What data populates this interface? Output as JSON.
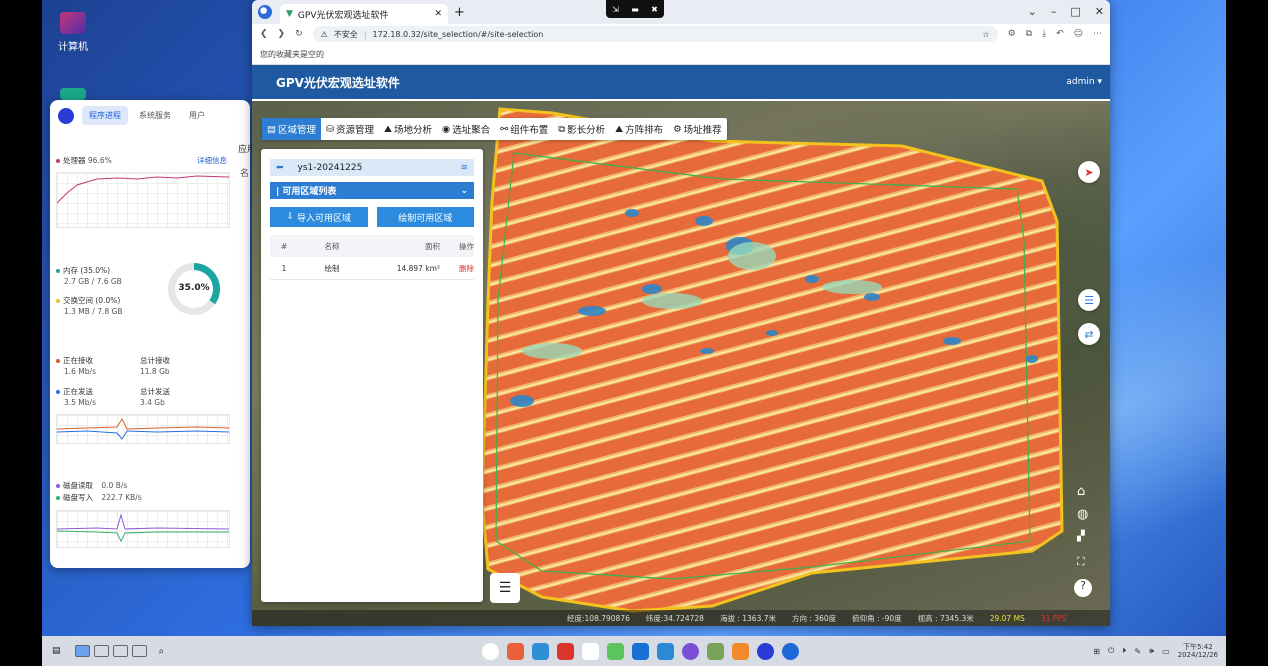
{
  "desktop": {
    "icon_label": "计算机"
  },
  "sysmon": {
    "tabs": [
      "程序进程",
      "系统服务",
      "用户"
    ],
    "cpu_label": "处理器",
    "cpu_value": "96.6%",
    "detail_link": "详细信息",
    "mem_label": "内存 (35.0%)",
    "mem_value": "2.7 GB / 7.6 GB",
    "swap_label": "交换空间 (0.0%)",
    "swap_value": "1.3 MB / 7.8 GB",
    "donut_value": "35.0%",
    "recv_label": "正在接收",
    "recv_value": "1.6 Mb/s",
    "total_recv_label": "总计接收",
    "total_recv_value": "11.8 Gb",
    "send_label": "正在发送",
    "send_value": "3.5 Mb/s",
    "total_send_label": "总计发送",
    "total_send_value": "3.4 Gb",
    "disk_read_label": "磁盘读取",
    "disk_read_value": "0.0 B/s",
    "disk_write_label": "磁盘写入",
    "disk_write_value": "222.7 KB/s",
    "edge_text_1": "应用",
    "edge_text_2": "名"
  },
  "browser": {
    "tab_title": "GPV光伏宏观选址软件",
    "new_tab": "+",
    "insecure": "不安全",
    "url": "172.18.0.32/site_selection/#/site-selection",
    "bookmarks_empty": "您的收藏夹是空的"
  },
  "app": {
    "title": "GPV光伏宏观选址软件",
    "user": "admin",
    "toolbar": [
      {
        "label": "区域管理",
        "icon": "map-icon"
      },
      {
        "label": "资源管理",
        "icon": "database-icon"
      },
      {
        "label": "场地分析",
        "icon": "terrain-icon"
      },
      {
        "label": "选址聚合",
        "icon": "pin-icon"
      },
      {
        "label": "组件布置",
        "icon": "share-icon"
      },
      {
        "label": "影长分析",
        "icon": "copy-icon"
      },
      {
        "label": "方阵排布",
        "icon": "mountain-icon"
      },
      {
        "label": "场址推荐",
        "icon": "site-icon"
      }
    ],
    "panel": {
      "plan_name": "ys1-20241225",
      "list_title": "| 可用区域列表",
      "import_btn": "导入可用区域",
      "draw_btn": "绘制可用区域",
      "columns": [
        "#",
        "名称",
        "面积",
        "操作"
      ],
      "rows": [
        {
          "idx": "1",
          "name": "绘制",
          "area": "14.897 km²",
          "action": "删除"
        }
      ]
    },
    "status": {
      "lon": "经度:108.790876",
      "lat": "纬度:34.724728",
      "alt": "海拔 : 1363.7米",
      "heading": "方向 : 360度",
      "pitch": "俯仰角 : -90度",
      "height": "视高 : 7345.3米",
      "ms": "29.07 MS",
      "fps": "31 FPS"
    }
  },
  "taskbar": {
    "time": "下午5:42",
    "date": "2024/12/26"
  }
}
